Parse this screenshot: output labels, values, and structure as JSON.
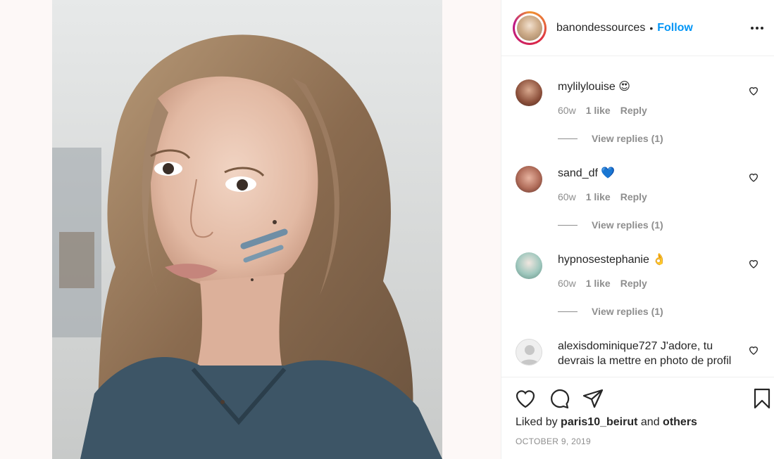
{
  "post": {
    "owner": "banondessources",
    "dot": "•",
    "follow_label": "Follow",
    "more_icon": "more-horizontal-icon",
    "liked_prefix": "Liked by",
    "liked_user": "paris10_beirut",
    "liked_and": "and",
    "liked_others": "others",
    "date": "OCTOBER 9, 2019"
  },
  "comments": [
    {
      "user": "mylilylouise",
      "emoji": "😍",
      "age": "60w",
      "likes": "1 like",
      "reply": "Reply",
      "view_replies": "View replies (1)"
    },
    {
      "user": "sand_df",
      "emoji": "💙",
      "age": "60w",
      "likes": "1 like",
      "reply": "Reply",
      "view_replies": "View replies (1)"
    },
    {
      "user": "hypnosestephanie",
      "emoji": "👌",
      "age": "60w",
      "likes": "1 like",
      "reply": "Reply",
      "view_replies": "View replies (1)"
    },
    {
      "user": "alexisdominique727",
      "text": "J'adore, tu devrais la mettre en photo de profil"
    }
  ],
  "colors": {
    "accent": "#0095f6",
    "text": "#262626",
    "muted": "#8e8e8e",
    "border": "#efefef"
  }
}
